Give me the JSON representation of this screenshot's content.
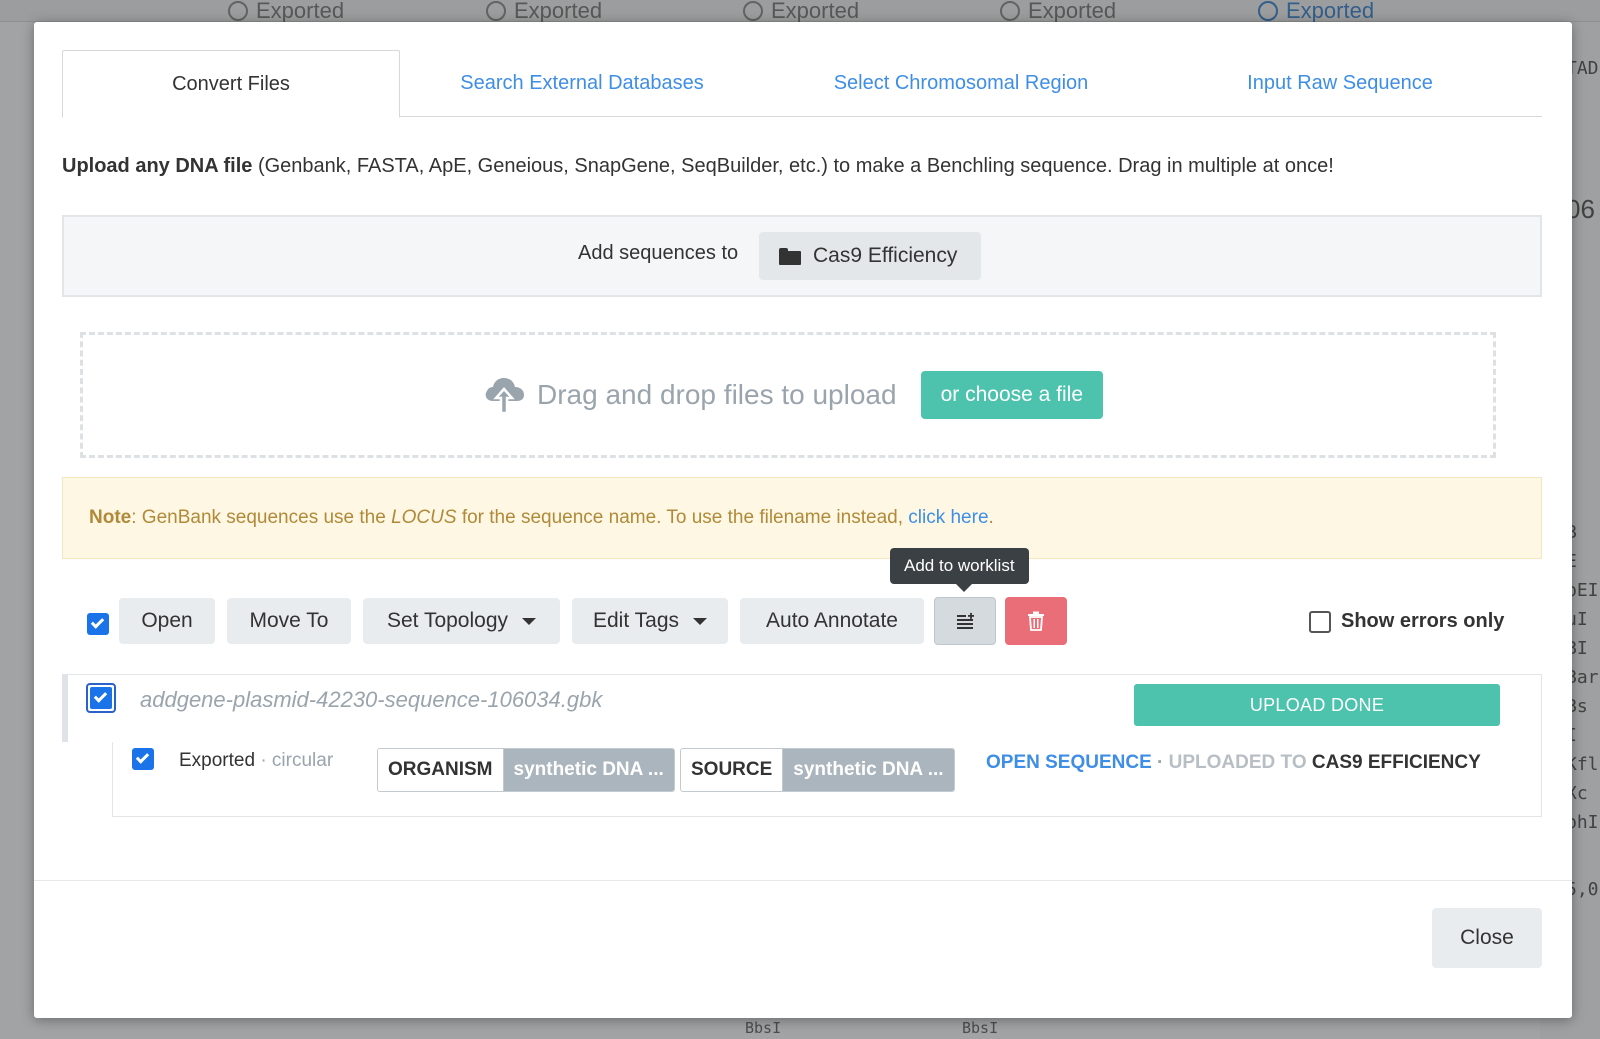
{
  "background": {
    "tab_label": "Exported",
    "right_fragments": [
      "TAD",
      "06",
      "B",
      "E",
      "pEI",
      "uI",
      "BI",
      "Bar",
      "Bs",
      "I",
      "Kfl",
      "Xc",
      "phI",
      "5,0"
    ],
    "bottom_fragments": [
      "BbsI",
      "BbsI"
    ]
  },
  "modal": {
    "tabs": [
      {
        "label": "Convert Files",
        "active": true
      },
      {
        "label": "Search External Databases",
        "active": false
      },
      {
        "label": "Select Chromosomal Region",
        "active": false
      },
      {
        "label": "Input Raw Sequence",
        "active": false
      }
    ],
    "intro": {
      "bold": "Upload any DNA file",
      "rest": " (Genbank, FASTA, ApE, Geneious, SnapGene, SeqBuilder, etc.) to make a Benchling sequence. Drag in multiple at once!"
    },
    "destination": {
      "label": "Add sequences to",
      "folder": "Cas9 Efficiency"
    },
    "dropzone": {
      "text": "Drag and drop files to upload",
      "choose_label": "or choose a file"
    },
    "note": {
      "prefix": "Note",
      "part1": ": GenBank sequences use the ",
      "locus": "LOCUS",
      "part2": " for the sequence name. To use the filename instead, ",
      "link": "click here",
      "end": "."
    },
    "tooltip": "Add to worklist",
    "toolbar": {
      "open": "Open",
      "move_to": "Move To",
      "set_topology": "Set Topology",
      "edit_tags": "Edit Tags",
      "auto_annotate": "Auto Annotate",
      "show_errors_only": "Show errors only"
    },
    "file": {
      "name": "addgene-plasmid-42230-sequence-106034.gbk",
      "status": "UPLOAD DONE"
    },
    "sequence": {
      "name": "Exported",
      "topology": " · circular",
      "tags": [
        {
          "key": "ORGANISM",
          "value": "synthetic DNA ..."
        },
        {
          "key": "SOURCE",
          "value": "synthetic DNA ..."
        }
      ],
      "open_link": "OPEN SEQUENCE",
      "separator": " · ",
      "uploaded_to": "UPLOADED TO ",
      "destination": "CAS9 EFFICIENCY"
    },
    "close_label": "Close"
  },
  "colors": {
    "accent_blue": "#3e8ee6",
    "teal": "#4dc3ae",
    "danger": "#ea6e77",
    "note_text": "#b08a38"
  }
}
